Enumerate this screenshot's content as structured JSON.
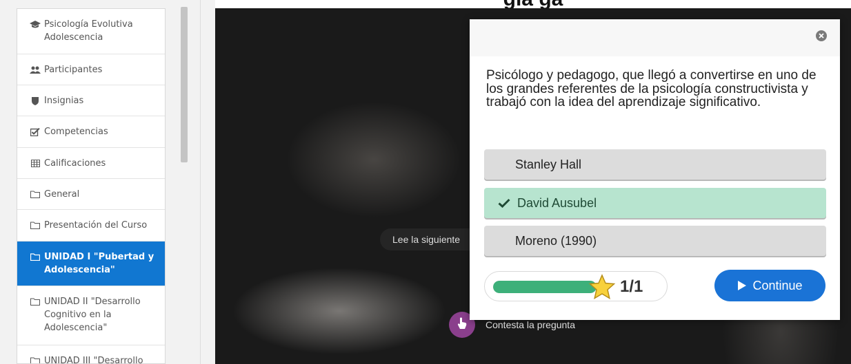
{
  "header": {
    "title_fragment": "gla                              ga"
  },
  "sidebar": {
    "items": [
      {
        "label": "Psicología Evolutiva Adolescencia",
        "icon": "graduation-cap-icon",
        "active": false
      },
      {
        "label": "Participantes",
        "icon": "users-icon",
        "active": false
      },
      {
        "label": "Insignias",
        "icon": "shield-icon",
        "active": false
      },
      {
        "label": "Competencias",
        "icon": "checkbox-icon",
        "active": false
      },
      {
        "label": "Calificaciones",
        "icon": "table-icon",
        "active": false
      },
      {
        "label": "General",
        "icon": "folder-icon",
        "active": false
      },
      {
        "label": "Presentación del Curso",
        "icon": "folder-icon",
        "active": false
      },
      {
        "label": "UNIDAD I \"Pubertad y Adolescencia\"",
        "icon": "folder-icon",
        "active": true
      },
      {
        "label": "UNIDAD II \"Desarrollo Cognitivo en la Adolescencia\"",
        "icon": "folder-icon",
        "active": false
      },
      {
        "label": "UNIDAD III \"Desarrollo",
        "icon": "folder-icon",
        "active": false
      }
    ]
  },
  "video": {
    "overlay_label": "Lee la siguiente",
    "hotspot_label": "Contesta la pregunta",
    "hotspot_icon": "hand-pointer-icon"
  },
  "modal": {
    "question": "Psicólogo y pedagogo, que llegó a convertirse en uno de los grandes referentes de la psicología constructivista y trabajó con la idea del aprendizaje significativo.",
    "answers": [
      {
        "label": "Stanley Hall",
        "correct": false
      },
      {
        "label": "David Ausubel",
        "correct": true
      },
      {
        "label": "Moreno (1990)",
        "correct": false
      }
    ],
    "progress_fraction": 1.0,
    "score": "1/1",
    "continue_label": "Continue"
  },
  "colors": {
    "active_nav": "#1177d1",
    "correct_answer_bg": "#b7e4cf",
    "progress_fill": "#3db07a",
    "continue_button": "#1a73d6",
    "hotspot": "#8a3f8c"
  }
}
